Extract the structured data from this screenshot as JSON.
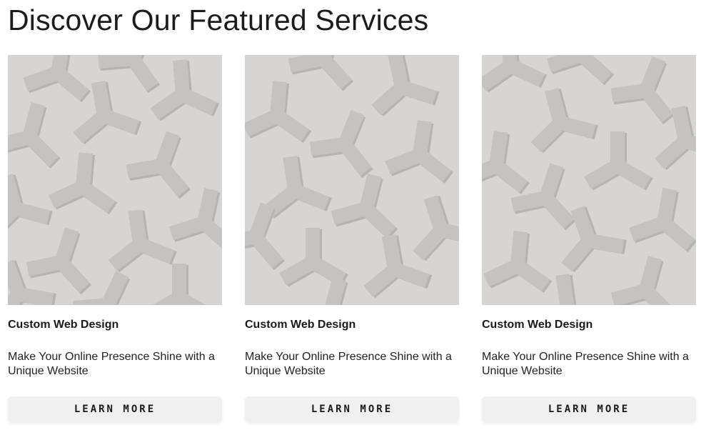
{
  "page": {
    "title": "Discover Our Featured Services"
  },
  "cards": [
    {
      "title": "Custom Web Design",
      "description": "Make Your Online Presence Shine with a Unique Website",
      "button_label": "LEARN MORE"
    },
    {
      "title": "Custom Web Design",
      "description": "Make Your Online Presence Shine with a Unique Website",
      "button_label": "LEARN MORE"
    },
    {
      "title": "Custom Web Design",
      "description": "Make Your Online Presence Shine with a Unique Website",
      "button_label": "LEARN MORE"
    }
  ],
  "colors": {
    "image_background": "#d6d5d3",
    "pattern_shape": "#c4c3c1",
    "pattern_shadow": "#b5b4b2",
    "button_background": "#f0f0f0"
  }
}
